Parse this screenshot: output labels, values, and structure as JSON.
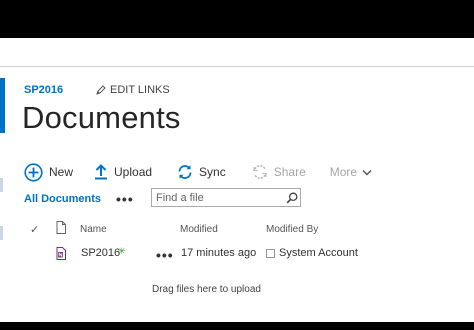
{
  "site": {
    "title": "SP2016",
    "edit_links": "EDIT LINKS"
  },
  "page": {
    "title": "Documents"
  },
  "toolbar": {
    "new_label": "New",
    "upload_label": "Upload",
    "sync_label": "Sync",
    "share_label": "Share",
    "more_label": "More"
  },
  "views": {
    "current": "All Documents",
    "more": "•••",
    "search_placeholder": "Find a file"
  },
  "columns": {
    "check": "✓",
    "name": "Name",
    "modified": "Modified",
    "modified_by": "Modified By"
  },
  "rows": [
    {
      "name": "SP2016",
      "new_badge": "✳",
      "actions": "•••",
      "modified": "17 minutes ago",
      "modified_by": "System Account"
    }
  ],
  "drag_hint": "Drag files here to upload",
  "icons": {
    "new": "plus-circle-icon",
    "upload": "upload-arrow-icon",
    "sync": "sync-icon",
    "share": "share-icon",
    "more": "chevron-down-icon",
    "search": "search-icon",
    "edit": "pencil-icon",
    "file_type": "document-icon",
    "file": "onenote-icon",
    "presence": "presence-icon"
  },
  "colors": {
    "accent": "#0072c6",
    "new_badge": "#2ca02c",
    "disabled": "#a6a6a6",
    "background": "#ffffff"
  }
}
